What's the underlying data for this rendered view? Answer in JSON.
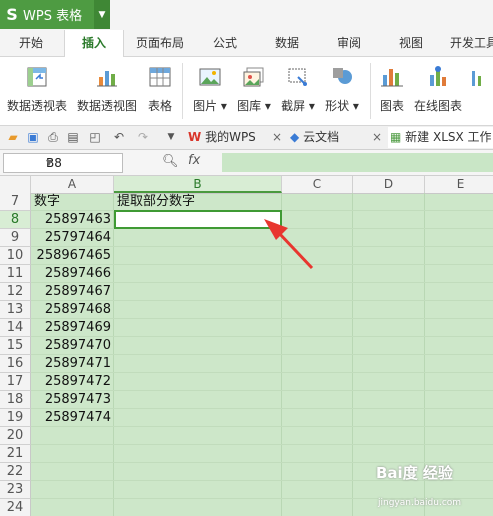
{
  "app": {
    "logo": "S",
    "title": "WPS 表格"
  },
  "ribbon_tabs": [
    "开始",
    "插入",
    "页面布局",
    "公式",
    "数据",
    "审阅",
    "视图",
    "开发工具"
  ],
  "active_tab": "插入",
  "ribbon_buttons": [
    {
      "label": "数据透视表",
      "icon": "pivot-table-icon"
    },
    {
      "label": "数据透视图",
      "icon": "pivot-chart-icon"
    },
    {
      "label": "表格",
      "icon": "table-icon"
    },
    {
      "label": "图片",
      "icon": "picture-icon"
    },
    {
      "label": "图库",
      "icon": "gallery-icon"
    },
    {
      "label": "截屏",
      "icon": "screenshot-icon"
    },
    {
      "label": "形状",
      "icon": "shapes-icon"
    },
    {
      "label": "图表",
      "icon": "chart-icon"
    },
    {
      "label": "在线图表",
      "icon": "online-chart-icon"
    }
  ],
  "doc_tabs": {
    "mywps": "我的WPS",
    "cloud": "云文档",
    "file": "新建 XLSX 工作"
  },
  "name_box": "B8",
  "fx_label": "fx",
  "columns": [
    "A",
    "B",
    "C",
    "D",
    "E"
  ],
  "selected_column": "B",
  "rows": [
    {
      "n": "7",
      "a": "数字",
      "b": "提取部分数字"
    },
    {
      "n": "8",
      "a": "25897463",
      "b": ""
    },
    {
      "n": "9",
      "a": "25797464",
      "b": ""
    },
    {
      "n": "10",
      "a": "258967465",
      "b": ""
    },
    {
      "n": "11",
      "a": "25897466",
      "b": ""
    },
    {
      "n": "12",
      "a": "25897467",
      "b": ""
    },
    {
      "n": "13",
      "a": "25897468",
      "b": ""
    },
    {
      "n": "14",
      "a": "25897469",
      "b": ""
    },
    {
      "n": "15",
      "a": "25897470",
      "b": ""
    },
    {
      "n": "16",
      "a": "25897471",
      "b": ""
    },
    {
      "n": "17",
      "a": "25897472",
      "b": ""
    },
    {
      "n": "18",
      "a": "25897473",
      "b": ""
    },
    {
      "n": "19",
      "a": "25897474",
      "b": ""
    },
    {
      "n": "20",
      "a": "",
      "b": ""
    },
    {
      "n": "21",
      "a": "",
      "b": ""
    },
    {
      "n": "22",
      "a": "",
      "b": ""
    },
    {
      "n": "23",
      "a": "",
      "b": ""
    },
    {
      "n": "24",
      "a": "",
      "b": ""
    }
  ],
  "selected_row": "8",
  "watermark": "Bai度 经验",
  "watermark_url": "jingyan.baidu.com",
  "colors": {
    "accent": "#4e9b42",
    "sheet_bg": "#cde7c9",
    "arrow": "#e8362f"
  }
}
